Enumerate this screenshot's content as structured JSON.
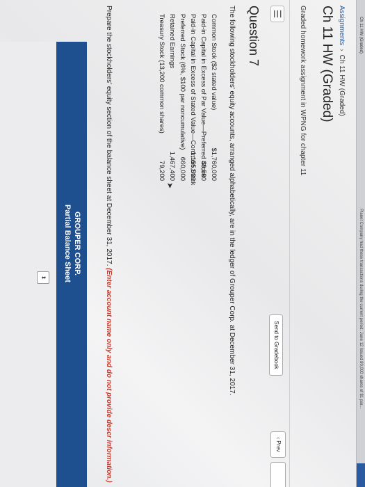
{
  "browser": {
    "tab_title": "Ch 11 HW (Graded)",
    "notice": "Planet Company had these transactions during the current period: June 12 Issued 80,000 shares of $1 par..."
  },
  "breadcrumb": {
    "root": "Assignments",
    "separator": "›",
    "current": "Ch 11 HW (Graded)"
  },
  "page": {
    "title": "Ch 11 HW (Graded)",
    "subtitle": "Graded homework assignment in WPNG for chapter 11"
  },
  "toolbar": {
    "menu_glyph": "☰",
    "gradebook_label": "Send to Gradebook",
    "prev_label": "‹ Prev"
  },
  "question": {
    "title": "Question 7",
    "intro": "The following stockholders' equity accounts, arranged alphabetically, are in the ledger of Grouper Corp. at December 31, 2017.",
    "accounts": [
      {
        "name": "Common Stock ($2 stated value)",
        "amount": "$1,760,000"
      },
      {
        "name": "Paid-in Capital in Excess of Par Value—Preferred Stock",
        "amount": "49,500"
      },
      {
        "name": "Paid-in Capital in Excess of Stated Value—Common Stock",
        "amount": "1,155,000"
      },
      {
        "name": "Preferred Stock (6%, $100 par noncumulative)",
        "amount": "660,000"
      },
      {
        "name": "Retained Earnings",
        "amount": "1,467,400"
      },
      {
        "name": "Treasury Stock (13,200 common shares)",
        "amount": "79,200"
      }
    ],
    "prompt": "Prepare the stockholders' equity section of the balance sheet at December 31, 2017.",
    "hint": "(Enter account name only and do not provide descr information.)"
  },
  "sheet": {
    "company": "GROUPER CORP.",
    "title": "Partial Balance Sheet",
    "dropdown_glyph": "⬍"
  },
  "colors": {
    "accent_blue": "#1e4f8e",
    "link_blue": "#1f5aa6",
    "hint_red": "#c0392b"
  }
}
